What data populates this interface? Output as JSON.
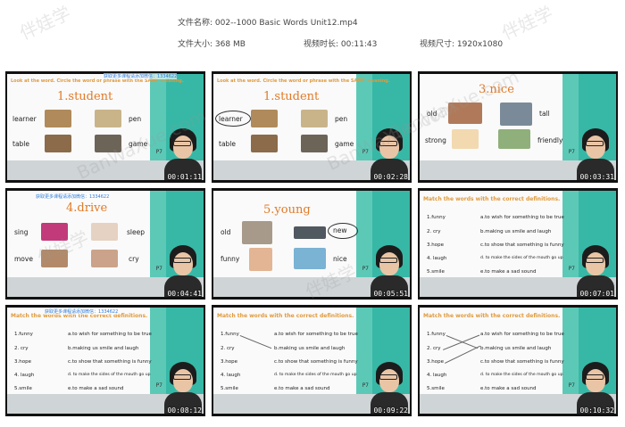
{
  "header": {
    "file_name_label": "文件名称:",
    "file_name": "002--1000 Basic Words Unit12.mp4",
    "file_size_label": "文件大小:",
    "file_size": "368 MB",
    "duration_label": "视频时长:",
    "duration": "00:11:43",
    "dimensions_label": "视频尺寸:",
    "dimensions": "1920x1080"
  },
  "watermarks": {
    "brand": "伴娃学",
    "site": "BanWaXue.com",
    "blue_tag": "获取更多课程请添加微信：1334622"
  },
  "instruction_look": "Look at the word. Circle the word or phrase with the SAME meaning.",
  "instruction_match": "Match the words with the correct definitions.",
  "page_label": "P7",
  "thumbs": [
    {
      "timestamp": "00:01:11",
      "title": "1.student",
      "words": [
        "learner",
        "pen",
        "table",
        "game"
      ]
    },
    {
      "timestamp": "00:02:28",
      "title": "1.student",
      "words": [
        "learner",
        "pen",
        "table",
        "game"
      ]
    },
    {
      "timestamp": "00:03:31",
      "title": "3.nice",
      "words": [
        "old",
        "tall",
        "strong",
        "friendly"
      ]
    },
    {
      "timestamp": "00:04:41",
      "title": "4.drive",
      "words": [
        "sing",
        "sleep",
        "move",
        "cry"
      ]
    },
    {
      "timestamp": "00:05:51",
      "title": "5.young",
      "words": [
        "old",
        "new",
        "funny",
        "nice"
      ]
    },
    {
      "timestamp": "00:07:01",
      "title": "",
      "words": []
    },
    {
      "timestamp": "00:08:12",
      "title": "",
      "words": []
    },
    {
      "timestamp": "00:09:22",
      "title": "",
      "words": []
    },
    {
      "timestamp": "00:10:32",
      "title": "",
      "words": []
    }
  ],
  "match_left": [
    "1.funny",
    "2. cry",
    "3.hope",
    "4. laugh",
    "5.smile"
  ],
  "match_right": [
    "a.to wish for something to be true",
    "b.making us smile and laugh",
    "c.to show that something is funny",
    "d. to make the sides of the mouth go up",
    "e.to make a sad sound"
  ]
}
